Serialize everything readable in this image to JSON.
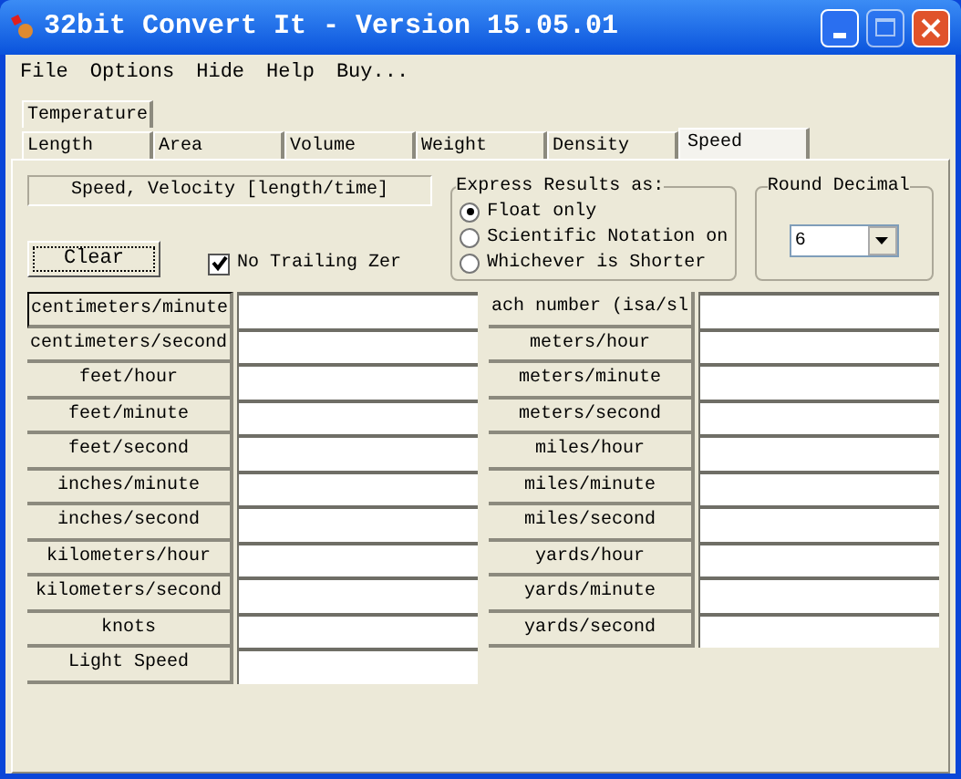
{
  "window": {
    "title": "32bit Convert It - Version 15.05.01"
  },
  "menu": [
    "File",
    "Options",
    "Hide",
    "Help",
    "Buy..."
  ],
  "tab_rows": [
    [
      {
        "label": "Temperature",
        "selected": false
      }
    ],
    [
      {
        "label": "Length",
        "selected": false
      },
      {
        "label": "Area",
        "selected": false
      },
      {
        "label": "Volume",
        "selected": false
      },
      {
        "label": "Weight",
        "selected": false
      },
      {
        "label": "Density",
        "selected": false
      },
      {
        "label": "Speed",
        "selected": true
      }
    ]
  ],
  "category_label": "Speed, Velocity [length/time]",
  "clear_button": "Clear",
  "no_trailing": {
    "label": "No Trailing Zer",
    "checked": true
  },
  "express": {
    "title": "Express Results as:",
    "options": [
      {
        "label": "Float only",
        "selected": true
      },
      {
        "label": "Scientific Notation on",
        "selected": false
      },
      {
        "label": "Whichever is Shorter",
        "selected": false
      }
    ]
  },
  "round_decimal": {
    "title": "Round Decimal",
    "value": "6"
  },
  "left_units": [
    "centimeters/minute",
    "centimeters/second",
    "feet/hour",
    "feet/minute",
    "feet/second",
    "inches/minute",
    "inches/second",
    "kilometers/hour",
    "kilometers/second",
    "knots",
    "Light Speed"
  ],
  "right_units": [
    "ach number (isa/sl",
    "meters/hour",
    "meters/minute",
    "meters/second",
    "miles/hour",
    "miles/minute",
    "miles/second",
    "yards/hour",
    "yards/minute",
    "yards/second"
  ]
}
